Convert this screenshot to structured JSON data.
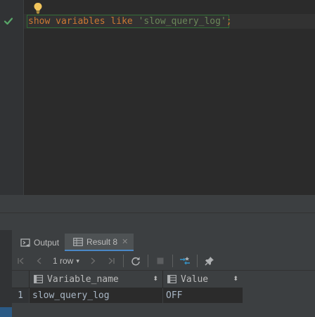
{
  "editor": {
    "code": {
      "keyword1": "show",
      "keyword2": "variables",
      "keyword3": "like",
      "string_literal": "'slow_query_log'",
      "terminator": ";"
    },
    "status_icon": "check-icon",
    "hint_icon": "lightbulb-icon"
  },
  "results_panel": {
    "tabs": [
      {
        "label": "Output",
        "icon": "output-icon",
        "active": false
      },
      {
        "label": "Result 8",
        "icon": "table-icon",
        "active": true,
        "closable": true
      }
    ],
    "toolbar": {
      "row_count": "1 row",
      "buttons": [
        "first-page-icon",
        "prev-page-icon",
        "next-page-icon",
        "last-page-icon",
        "refresh-icon",
        "stop-icon",
        "compare-icon",
        "pin-icon"
      ]
    },
    "grid": {
      "columns": [
        "Variable_name",
        "Value"
      ],
      "rows": [
        {
          "num": "1",
          "cells": [
            "slow_query_log",
            "OFF"
          ]
        }
      ]
    }
  },
  "colors": {
    "background": "#2b2b2b",
    "keyword": "#cc7832",
    "string": "#6a8759",
    "panel": "#3c3f41",
    "accent": "#4a88c7"
  }
}
